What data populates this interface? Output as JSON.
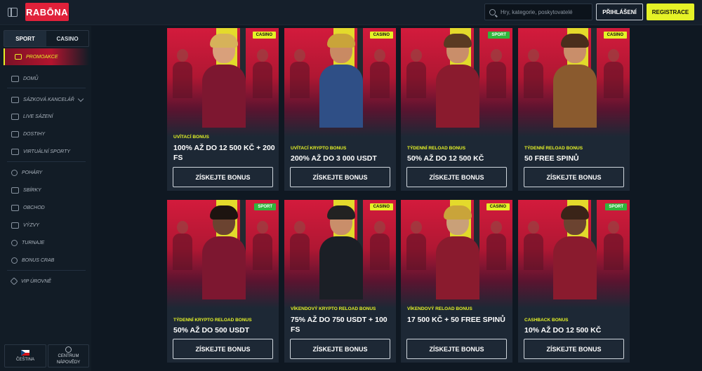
{
  "header": {
    "logo": "RABŌNA",
    "search_placeholder": "Hry, kategorie, poskytovatelé",
    "login_label": "PŘIHLÁŠENÍ",
    "register_label": "REGISTRACE"
  },
  "sidebar": {
    "tabs": [
      "SPORT",
      "CASINO"
    ],
    "promo_label": "PROMOAKCE",
    "items": [
      {
        "label": "DOMŮ",
        "icon": "home-icon"
      },
      {
        "label": "SÁZKOVÁ KANCELÁŘ",
        "icon": "betslip-icon"
      },
      {
        "label": "LIVE SÁZENÍ",
        "icon": "live-icon"
      },
      {
        "label": "DOSTIHY",
        "icon": "horse-icon"
      },
      {
        "label": "VIRTUÁLNÍ SPORTY",
        "icon": "virtual-sports-icon"
      },
      {
        "label": "POHÁRY",
        "icon": "trophy-icon"
      },
      {
        "label": "SBÍRKY",
        "icon": "collection-icon"
      },
      {
        "label": "OBCHOD",
        "icon": "cart-icon"
      },
      {
        "label": "VÝZVY",
        "icon": "flag-icon"
      },
      {
        "label": "TURNAJE",
        "icon": "cup-icon"
      },
      {
        "label": "BONUS CRAB",
        "icon": "crab-icon"
      },
      {
        "label": "VIP ÚROVNĚ",
        "icon": "diamond-icon"
      }
    ],
    "language_label": "ČEŠTINA",
    "help_label_1": "CENTRUM",
    "help_label_2": "NÁPOVĚDY"
  },
  "cards": [
    {
      "badge": "CASINO",
      "type": "UVÍTACÍ BONUS",
      "title": "100% AŽ DO 12 500 KČ + 200 FS",
      "cta": "ZÍSKEJTE BONUS"
    },
    {
      "badge": "CASINO",
      "type": "UVÍTACÍ KRYPTO BONUS",
      "title": "200% AŽ DO 3 000 USDT",
      "cta": "ZÍSKEJTE BONUS"
    },
    {
      "badge": "SPORT",
      "type": "TÝDENNÍ RELOAD BONUS",
      "title": "50% AŽ DO 12 500 KČ",
      "cta": "ZÍSKEJTE BONUS"
    },
    {
      "badge": "CASINO",
      "type": "TÝDENNÍ RELOAD BONUS",
      "title": "50 FREE SPINŮ",
      "cta": "ZÍSKEJTE BONUS"
    },
    {
      "badge": "SPORT",
      "type": "TÝDENNÍ KRYPTO RELOAD BONUS",
      "title": "50% AŽ DO 500 USDT",
      "cta": "ZÍSKEJTE BONUS"
    },
    {
      "badge": "CASINO",
      "type": "VÍKENDOVÝ KRYPTO RELOAD BONUS",
      "title": "75% AŽ DO 750 USDT + 100 FS",
      "cta": "ZÍSKEJTE BONUS"
    },
    {
      "badge": "CASINO",
      "type": "VÍKENDOVÝ RELOAD BONUS",
      "title": "17 500 KČ + 50 FREE SPINŮ",
      "cta": "ZÍSKEJTE BONUS"
    },
    {
      "badge": "SPORT",
      "type": "CASHBACK BONUS",
      "title": "10% AŽ DO 12 500 KČ",
      "cta": "ZÍSKEJTE BONUS"
    }
  ],
  "colors": {
    "accent": "#e5f227",
    "brand": "#e0213a",
    "sport_badge": "#2fb63c"
  }
}
